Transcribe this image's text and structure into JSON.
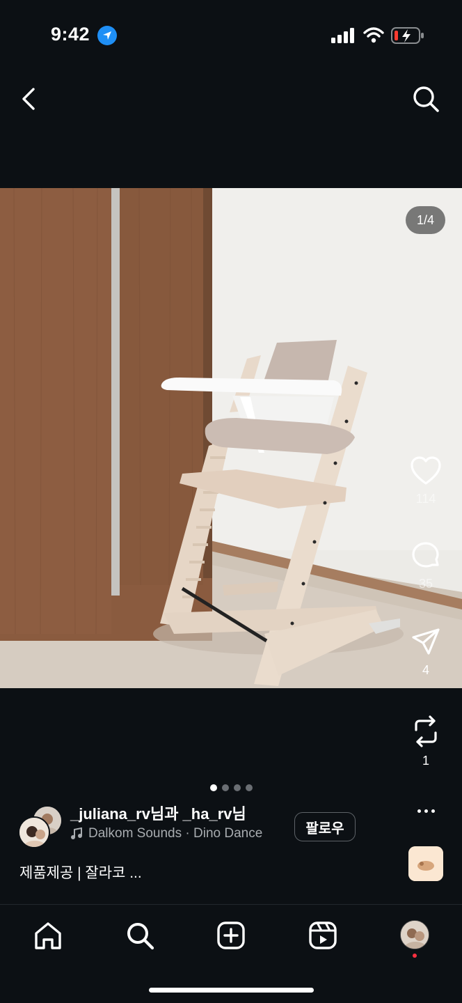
{
  "status_bar": {
    "time": "9:42",
    "icons": [
      "location-arrow-icon",
      "cellular-signal-icon",
      "wifi-icon",
      "battery-low-charging-icon"
    ]
  },
  "nav": {
    "back_icon": "chevron-left-icon",
    "search_icon": "search-icon"
  },
  "post": {
    "image_counter": "1/4",
    "carousel": {
      "total": 4,
      "active": 1
    },
    "actions": {
      "like_count": "114",
      "comment_count": "35",
      "share_count": "4",
      "repost_count": "1"
    },
    "author": "_juliana_rv님과 _ha_rv님",
    "music": "Dalkom Sounds · Dino Dance",
    "follow_label": "팔로우",
    "caption": "제품제공 | 잘라코 ..."
  },
  "tab_bar": {
    "items": [
      "home-icon",
      "search-icon",
      "create-icon",
      "reels-icon",
      "profile-avatar"
    ]
  },
  "colors": {
    "background": "#0c1014",
    "accent_blue": "#1f8ff5",
    "notification_red": "#ff3040"
  }
}
